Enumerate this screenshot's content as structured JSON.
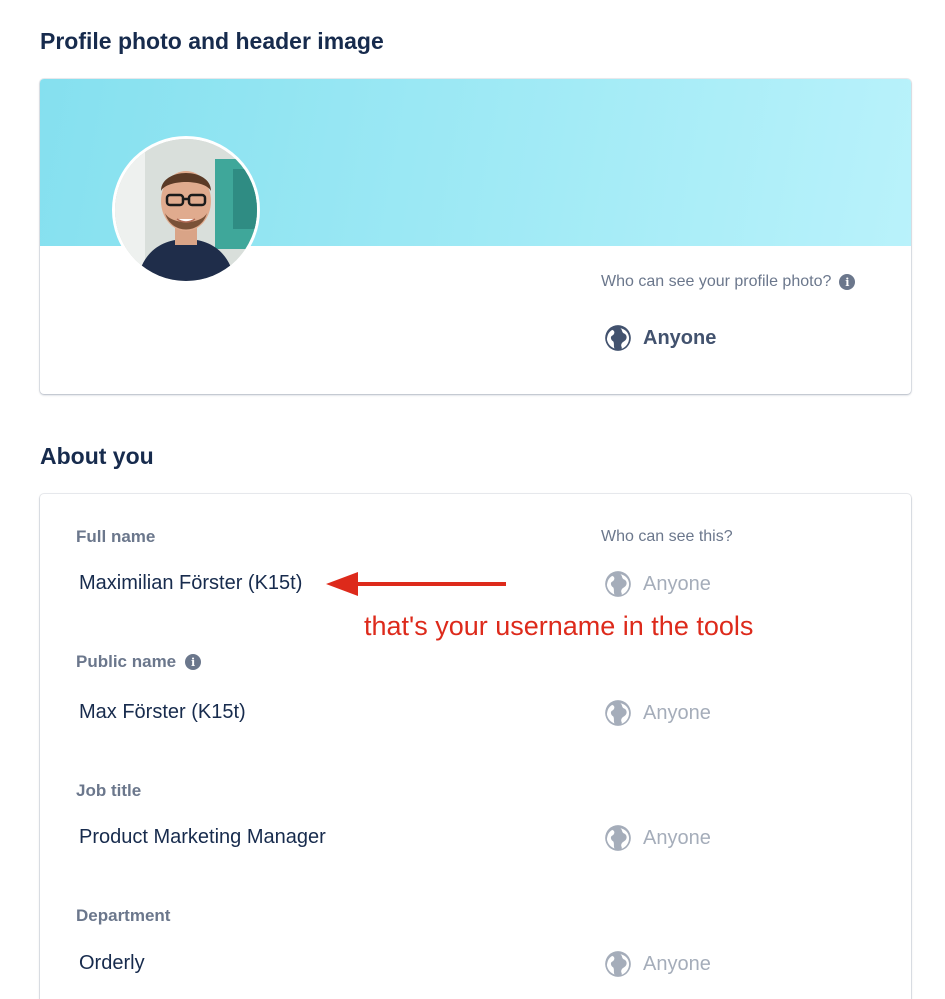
{
  "sections": {
    "photo_title": "Profile photo and header image",
    "about_title": "About you"
  },
  "photo_card": {
    "visibility_question": "Who can see your profile photo?",
    "visibility_value": "Anyone"
  },
  "about": {
    "visibility_header": "Who can see this?",
    "fields": [
      {
        "label": "Full name",
        "value": "Maximilian Förster (K15t)",
        "visibility": "Anyone"
      },
      {
        "label": "Public name",
        "value": "Max Förster (K15t)",
        "visibility": "Anyone"
      },
      {
        "label": "Job title",
        "value": "Product Marketing Manager",
        "visibility": "Anyone"
      },
      {
        "label": "Department",
        "value": "Orderly",
        "visibility": "Anyone"
      }
    ]
  },
  "annotation": {
    "text": "that's your username in the tools",
    "color": "#dd2a1b"
  },
  "icons": {
    "info": "info-icon",
    "globe": "globe-icon",
    "arrow": "arrow-left-icon"
  },
  "info_glyph": "i",
  "colors": {
    "header_gradient_start": "#85e0ef",
    "header_gradient_end": "#b9f2fb",
    "heading": "#172b4d",
    "muted": "#6b778c",
    "disabled": "#a5adba"
  }
}
